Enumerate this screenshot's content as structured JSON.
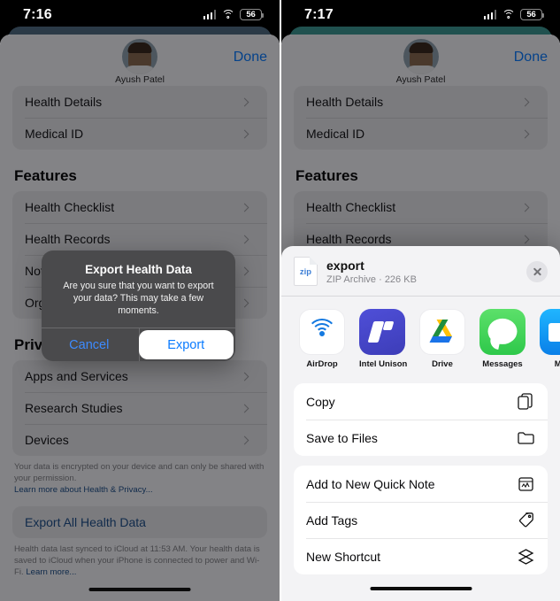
{
  "left": {
    "status": {
      "time": "7:16",
      "battery": "56",
      "signal_icon": "cellular-signal-icon",
      "wifi_icon": "wifi-icon"
    },
    "header": {
      "user_name": "Ayush Patel",
      "done_label": "Done"
    },
    "groups": [
      {
        "rows": [
          {
            "label": "Health Details"
          },
          {
            "label": "Medical ID"
          }
        ]
      }
    ],
    "features_title": "Features",
    "features_rows": [
      {
        "label": "Health Checklist"
      },
      {
        "label": "Health Records"
      },
      {
        "label": "Notifications"
      },
      {
        "label": "Organ Donation"
      }
    ],
    "privacy_title": "Privacy",
    "privacy_rows": [
      {
        "label": "Apps and Services"
      },
      {
        "label": "Research Studies"
      },
      {
        "label": "Devices"
      }
    ],
    "privacy_footer": "Your data is encrypted on your device and can only be shared with your permission.",
    "privacy_link": "Learn more about Health & Privacy...",
    "export_row": "Export All Health Data",
    "sync_footer": "Health data last synced to iCloud at 11:53 AM. Your health data is saved to iCloud when your iPhone is connected to power and Wi-Fi.",
    "sync_link": "Learn more...",
    "alert": {
      "title": "Export Health Data",
      "message": "Are you sure that you want to export your data? This may take a few moments.",
      "cancel_label": "Cancel",
      "confirm_label": "Export"
    }
  },
  "right": {
    "status": {
      "time": "7:17",
      "battery": "56",
      "signal_icon": "cellular-signal-icon",
      "wifi_icon": "wifi-icon"
    },
    "header": {
      "user_name": "Ayush Patel",
      "done_label": "Done"
    },
    "groups": [
      {
        "rows": [
          {
            "label": "Health Details"
          },
          {
            "label": "Medical ID"
          }
        ]
      }
    ],
    "features_title": "Features",
    "features_rows": [
      {
        "label": "Health Checklist"
      },
      {
        "label": "Health Records"
      }
    ],
    "share": {
      "file_name": "export",
      "file_meta": "ZIP Archive · 226 KB",
      "file_icon_label": "zip",
      "close_icon": "close-icon",
      "apps": [
        {
          "name": "AirDrop",
          "icon": "airdrop-icon"
        },
        {
          "name": "Intel Unison",
          "icon": "intel-unison-icon"
        },
        {
          "name": "Drive",
          "icon": "google-drive-icon"
        },
        {
          "name": "Messages",
          "icon": "messages-icon"
        },
        {
          "name": "Mail",
          "icon": "mail-icon"
        }
      ],
      "actions_group_1": [
        {
          "label": "Copy",
          "icon": "copy-icon"
        },
        {
          "label": "Save to Files",
          "icon": "folder-icon"
        }
      ],
      "actions_group_2": [
        {
          "label": "Add to New Quick Note",
          "icon": "quick-note-icon"
        },
        {
          "label": "Add Tags",
          "icon": "tag-icon"
        },
        {
          "label": "New Shortcut",
          "icon": "shortcuts-icon"
        }
      ]
    }
  },
  "colors": {
    "accent_blue": "#0a7bff",
    "link_blue": "#21518c",
    "sheet_bg": "#f2f2f7",
    "alert_bg": "#4a4a4c"
  }
}
